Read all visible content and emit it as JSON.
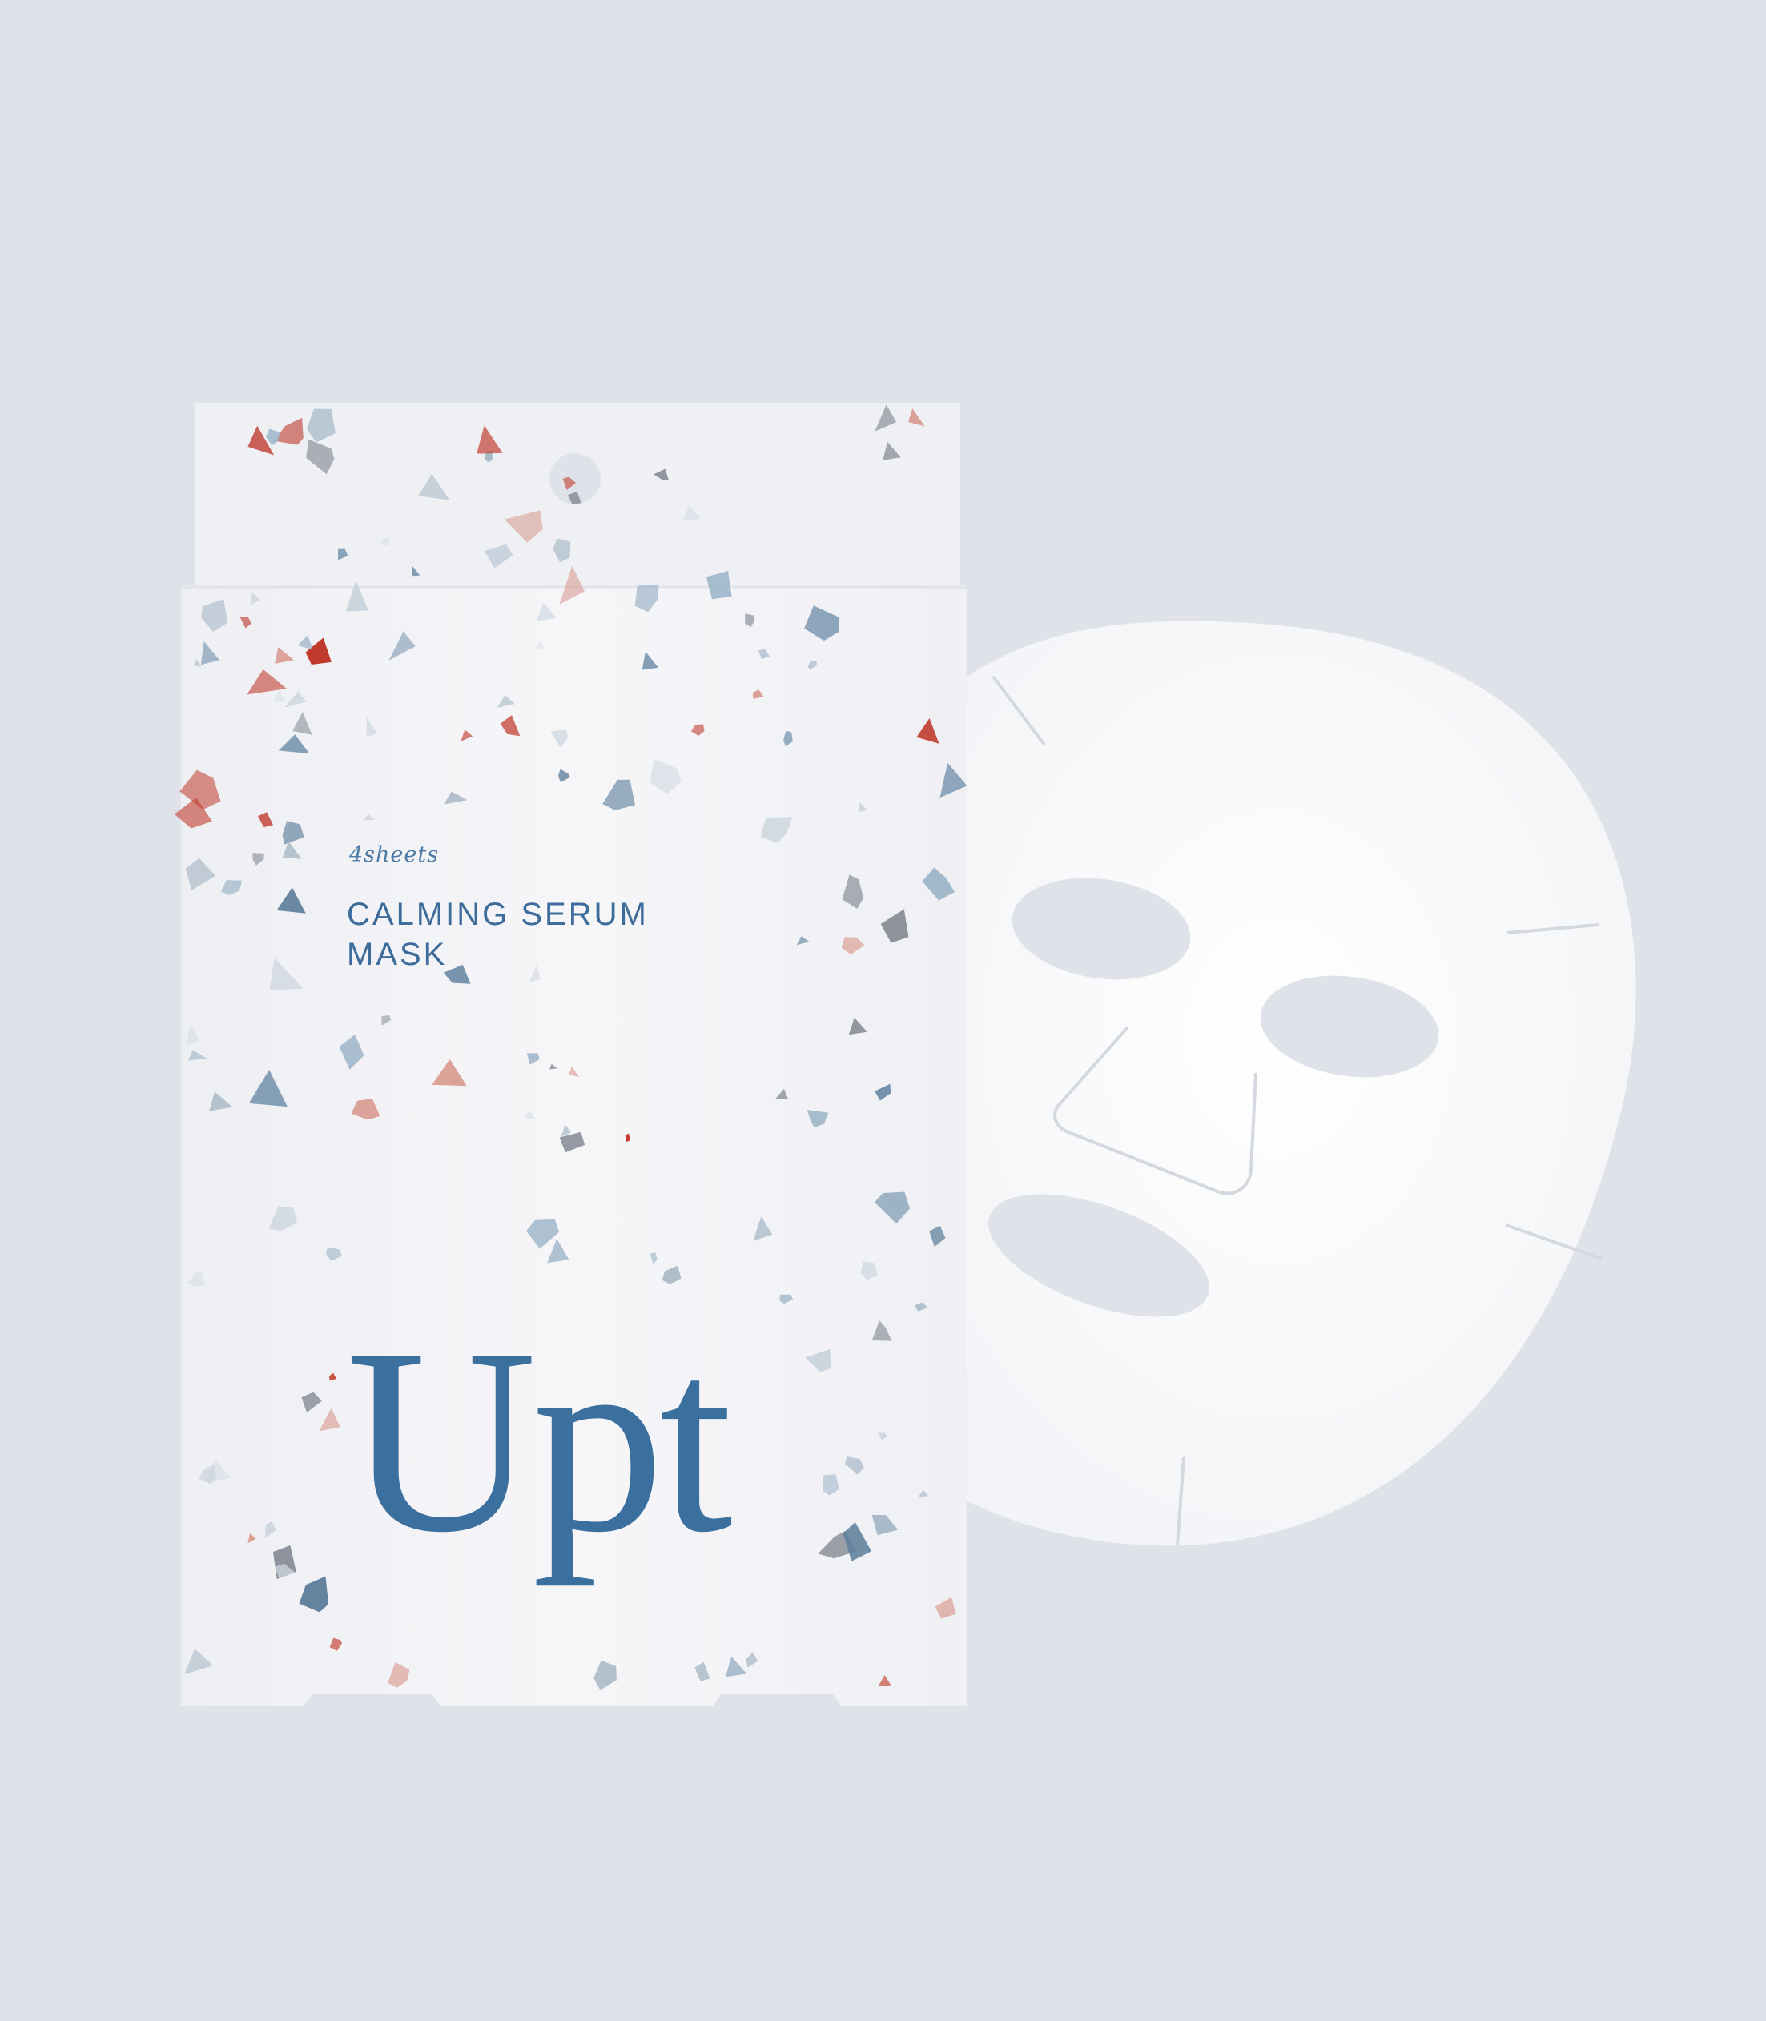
{
  "background_color": "#dfe3e9",
  "package": {
    "sheet_count": "4sheets",
    "product_name_line1": "CALMING SERUM",
    "product_name_line2": "MASK",
    "brand_logo": "Upt",
    "text_color": "#3d6c9b",
    "box_color": "#f3f3f6"
  },
  "sheet_mask": {
    "color": "#fbfbfc",
    "cutout_color": "#dfe3e9"
  }
}
